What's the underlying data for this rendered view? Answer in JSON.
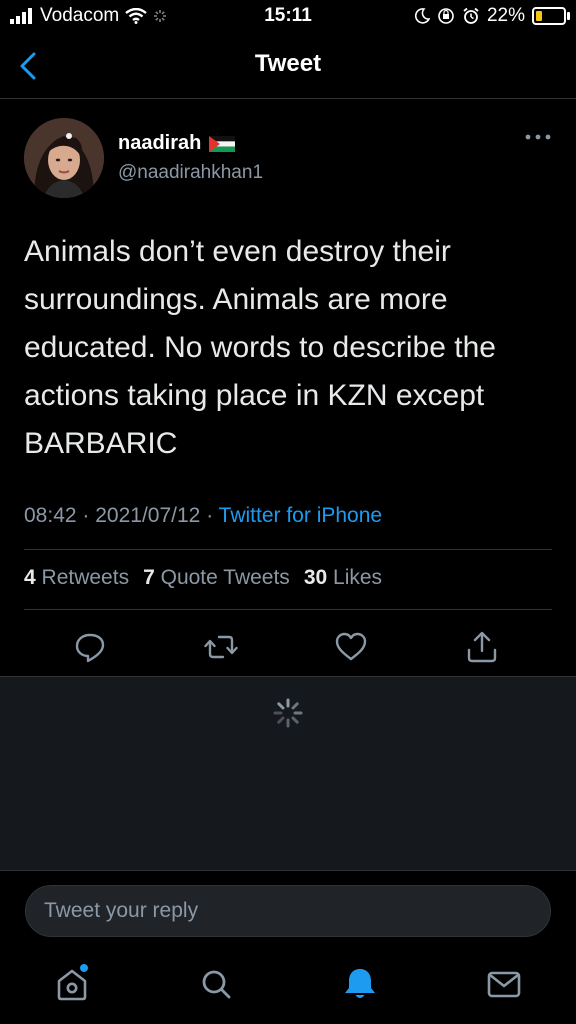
{
  "status_bar": {
    "carrier": "Vodacom",
    "time": "15:11",
    "battery_percent": "22%",
    "battery_level": 0.22,
    "battery_color": "#f5c518"
  },
  "nav": {
    "title": "Tweet",
    "back_icon": "chevron-left-icon"
  },
  "tweet": {
    "author_name": "naadirah",
    "author_handle": "@naadirahkhan1",
    "flag_icon": "palestine-flag-icon",
    "text": "Animals don’t even destroy their surroundings. Animals are more educated. No words to describe the actions taking place in KZN except BARBARIC",
    "time": "08:42",
    "separator": "·",
    "date": "2021/07/12",
    "source": "Twitter for iPhone",
    "retweets": "4",
    "retweets_label": "Retweets",
    "quote_tweets": "7",
    "quote_tweets_label": "Quote Tweets",
    "likes": "30",
    "likes_label": "Likes"
  },
  "actions": [
    "reply-icon",
    "retweet-icon",
    "like-icon",
    "share-icon"
  ],
  "reply": {
    "placeholder": "Tweet your reply"
  },
  "tab_bar": {
    "items": [
      "home-icon",
      "search-icon",
      "notifications-icon",
      "messages-icon"
    ],
    "active": "notifications-icon"
  },
  "colors": {
    "accent": "#1d9bf0",
    "background": "#000000",
    "secondary_text": "#8b98a5",
    "divider": "#2f3336",
    "replies_background": "#15181c"
  }
}
